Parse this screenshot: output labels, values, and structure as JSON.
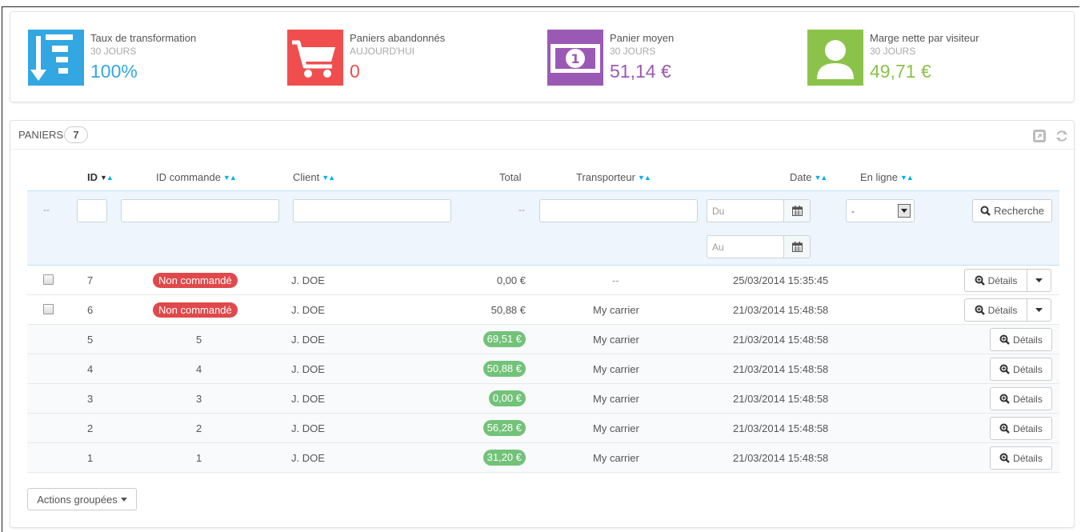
{
  "kpis": [
    {
      "title": "Taux de transformation",
      "sub": "30 JOURS",
      "value": "100%",
      "color": "#32a7e1",
      "icon": "sort-down-icon"
    },
    {
      "title": "Paniers abandonnés",
      "sub": "AUJOURD'HUI",
      "value": "0",
      "color": "#f04e4e",
      "icon": "shopping-cart-icon"
    },
    {
      "title": "Panier moyen",
      "sub": "30 JOURS",
      "value": "51,14 €",
      "color": "#9b59b6",
      "icon": "money-icon"
    },
    {
      "title": "Marge nette par visiteur",
      "sub": "30 JOURS",
      "value": "49,71 €",
      "color": "#8bc34a",
      "icon": "user-icon"
    }
  ],
  "panel": {
    "title": "PANIERS",
    "count": "7"
  },
  "columns": {
    "id": "ID",
    "order_id": "ID commande",
    "client": "Client",
    "total": "Total",
    "carrier": "Transporteur",
    "date": "Date",
    "online": "En ligne"
  },
  "filters": {
    "dash1": "--",
    "dash2": "--",
    "date_from_placeholder": "Du",
    "date_to_placeholder": "Au",
    "online_value": "-",
    "search_label": "Recherche"
  },
  "rows": [
    {
      "id": "7",
      "order": "Non commandé",
      "ordered": false,
      "client": "J. DOE",
      "total": "0,00 €",
      "paid": false,
      "carrier": "--",
      "date": "25/03/2014 15:35:45",
      "checkbox": true
    },
    {
      "id": "6",
      "order": "Non commandé",
      "ordered": false,
      "client": "J. DOE",
      "total": "50,88 €",
      "paid": false,
      "carrier": "My carrier",
      "date": "21/03/2014 15:48:58",
      "checkbox": true
    },
    {
      "id": "5",
      "order": "5",
      "ordered": true,
      "client": "J. DOE",
      "total": "69,51 €",
      "paid": true,
      "carrier": "My carrier",
      "date": "21/03/2014 15:48:58",
      "checkbox": false
    },
    {
      "id": "4",
      "order": "4",
      "ordered": true,
      "client": "J. DOE",
      "total": "50,88 €",
      "paid": true,
      "carrier": "My carrier",
      "date": "21/03/2014 15:48:58",
      "checkbox": false
    },
    {
      "id": "3",
      "order": "3",
      "ordered": true,
      "client": "J. DOE",
      "total": "0,00 €",
      "paid": true,
      "carrier": "My carrier",
      "date": "21/03/2014 15:48:58",
      "checkbox": false
    },
    {
      "id": "2",
      "order": "2",
      "ordered": true,
      "client": "J. DOE",
      "total": "56,28 €",
      "paid": true,
      "carrier": "My carrier",
      "date": "21/03/2014 15:48:58",
      "checkbox": false
    },
    {
      "id": "1",
      "order": "1",
      "ordered": true,
      "client": "J. DOE",
      "total": "31,20 €",
      "paid": true,
      "carrier": "My carrier",
      "date": "21/03/2014 15:48:58",
      "checkbox": false
    }
  ],
  "details_label": "Détails",
  "bulk_actions_label": "Actions groupées",
  "colors": {
    "accent": "#00aff0",
    "danger": "#e0494b",
    "success": "#72c279"
  }
}
